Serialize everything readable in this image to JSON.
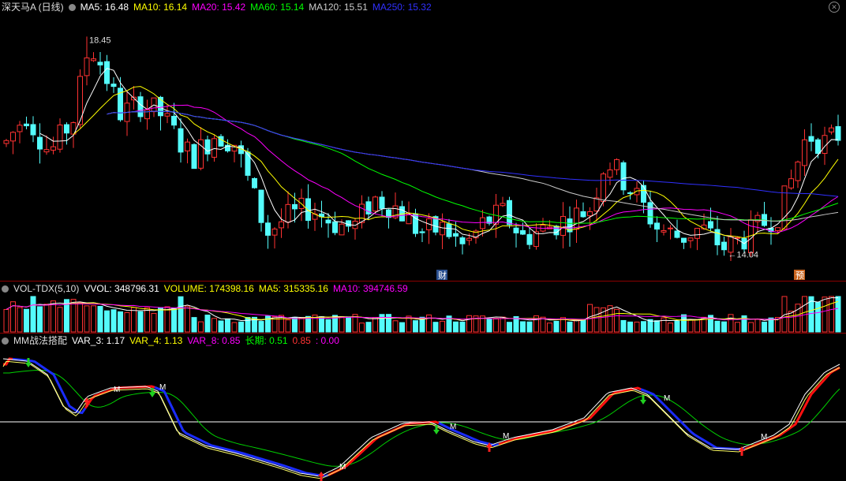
{
  "price_panel": {
    "title": "深天马A (日线)",
    "ma": [
      {
        "label": "MA5: 16.48",
        "color": "#ffffff"
      },
      {
        "label": "MA10: 16.14",
        "color": "#ffff00"
      },
      {
        "label": "MA20: 15.42",
        "color": "#ff00ff"
      },
      {
        "label": "MA60: 15.14",
        "color": "#00ff00"
      },
      {
        "label": "MA120: 15.51",
        "color": "#cccccc"
      },
      {
        "label": "MA250: 15.32",
        "color": "#3030ff"
      }
    ],
    "high_label": "18.45",
    "low_label": "←14.04",
    "tag_cai": "财",
    "tag_yu": "预"
  },
  "vol_panel": {
    "title": "VOL-TDX(5,10)",
    "items": [
      {
        "label": "VVOL: 348796.31",
        "color": "#ffffff"
      },
      {
        "label": "VOLUME: 174398.16",
        "color": "#ffff00"
      },
      {
        "label": "MA5: 315335.16",
        "color": "#ffff00"
      },
      {
        "label": "MA10: 394746.59",
        "color": "#ff00ff"
      }
    ]
  },
  "mm_panel": {
    "title": "MM战法搭配",
    "items": [
      {
        "label": "VAR_3: 1.17",
        "color": "#ffffff"
      },
      {
        "label": "VAR_4: 1.13",
        "color": "#ffff00"
      },
      {
        "label": "VAR_8: 0.85",
        "color": "#ff00ff"
      },
      {
        "label": "长期: 0.51",
        "color": "#00ff00"
      },
      {
        "label": "0.85",
        "color": "#ff0000"
      },
      {
        "label": ": 0.00",
        "color": "#ff00ff"
      }
    ],
    "marker_m": "M"
  },
  "chart_data": {
    "type": "candlestick",
    "y_range": [
      13.6,
      18.9
    ],
    "high": 18.45,
    "low": 14.04,
    "ma_latest": {
      "MA5": 16.48,
      "MA10": 16.14,
      "MA20": 15.42,
      "MA60": 15.14,
      "MA120": 15.51,
      "MA250": 15.32
    },
    "volume": {
      "VVOL": 348796.31,
      "VOLUME": 174398.16,
      "MA5": 315335.16,
      "MA10": 394746.59
    },
    "indicator": {
      "VAR_3": 1.17,
      "VAR_4": 1.13,
      "VAR_8": 0.85,
      "长期": 0.51
    }
  },
  "colors": {
    "up": "#ff3232",
    "down": "#54fcfc",
    "sep": "#8b0000"
  }
}
